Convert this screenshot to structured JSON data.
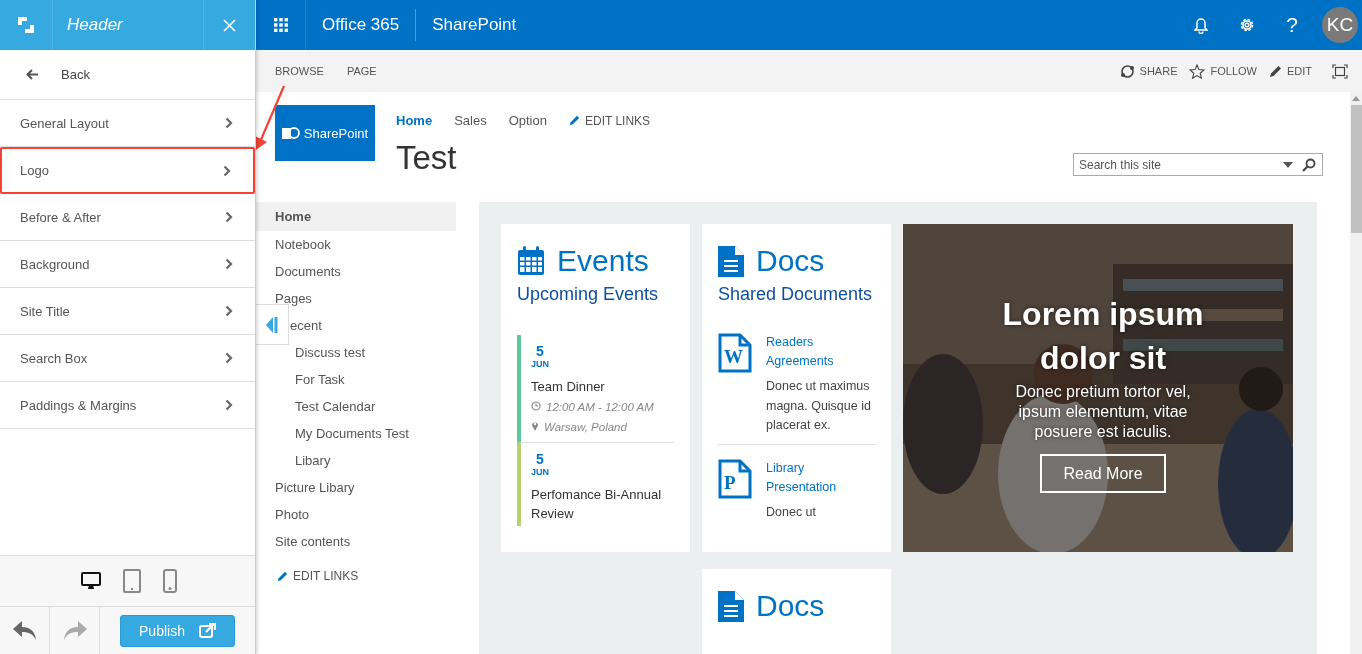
{
  "panel": {
    "title": "Header",
    "back": "Back",
    "items": [
      {
        "label": "General Layout",
        "highlighted": false
      },
      {
        "label": "Logo",
        "highlighted": true
      },
      {
        "label": "Before & After",
        "highlighted": false
      },
      {
        "label": "Background",
        "highlighted": false
      },
      {
        "label": "Site Title",
        "highlighted": false
      },
      {
        "label": "Search Box",
        "highlighted": false
      },
      {
        "label": "Paddings & Margins",
        "highlighted": false
      }
    ],
    "devices": [
      {
        "kind": "desktop",
        "selected": true
      },
      {
        "kind": "tablet",
        "selected": false
      },
      {
        "kind": "phone",
        "selected": false
      }
    ],
    "undo": {
      "disabled": false
    },
    "redo": {
      "disabled": true
    },
    "publish": "Publish"
  },
  "suite_bar": {
    "app": "Office 365",
    "product": "SharePoint",
    "help": "?",
    "avatar": "KC"
  },
  "ribbon": {
    "tabs": [
      "BROWSE",
      "PAGE"
    ],
    "actions": [
      {
        "kind": "share",
        "label": "SHARE"
      },
      {
        "kind": "follow",
        "label": "FOLLOW"
      },
      {
        "kind": "edit",
        "label": "EDIT"
      }
    ]
  },
  "site": {
    "logo_text": "SharePoint",
    "top_nav": [
      {
        "label": "Home",
        "selected": true
      },
      {
        "label": "Sales",
        "selected": false
      },
      {
        "label": "Option",
        "selected": false
      }
    ],
    "edit_links": "EDIT LINKS",
    "title": "Test",
    "search": {
      "placeholder": "Search this site"
    }
  },
  "quick_launch": {
    "items": [
      {
        "label": "Home",
        "selected": true
      },
      {
        "label": "Notebook",
        "selected": false
      },
      {
        "label": "Documents",
        "selected": false
      },
      {
        "label": "Pages",
        "selected": false
      },
      {
        "label": "ecent",
        "selected": false,
        "children": [
          {
            "label": "Discuss test",
            "selected": false
          },
          {
            "label": "For Task",
            "selected": false
          },
          {
            "label": "Test Calendar",
            "selected": false
          },
          {
            "label": "My Documents Test",
            "selected": false
          },
          {
            "label": "Libary",
            "selected": false
          }
        ]
      },
      {
        "label": "Picture Libary",
        "selected": false
      },
      {
        "label": "Photo",
        "selected": false
      },
      {
        "label": "Site contents",
        "selected": false
      }
    ],
    "edit_links": "EDIT LINKS"
  },
  "cards": [
    {
      "kind": "events",
      "title": "Events",
      "subtitle": "Upcoming Events",
      "events": [
        {
          "day": "5",
          "month": "JUN",
          "title": "Team Dinner",
          "time": "12:00 AM - 12:00 AM",
          "location": "Warsaw, Poland",
          "color": "#5ec99b"
        },
        {
          "day": "5",
          "month": "JUN",
          "title": "Perfomance Bi-Annual Review",
          "color": "#b5d36b"
        }
      ]
    },
    {
      "kind": "docs",
      "title": "Docs",
      "subtitle": "Shared Documents",
      "docs": [
        {
          "badge": "W",
          "title": "Readers Agreements",
          "text": "Donec ut maximus magna. Quisque id placerat ex."
        },
        {
          "badge": "P",
          "title": "Library Presentation",
          "text": "Donec ut"
        }
      ]
    },
    {
      "kind": "picture",
      "heading": "Lorem ipsum dolor sit",
      "text": "Donec pretium tortor vel, ipsum elementum, vitae posuere est iaculis.",
      "button": "Read More"
    },
    {
      "kind": "docs",
      "title": "Docs"
    }
  ]
}
